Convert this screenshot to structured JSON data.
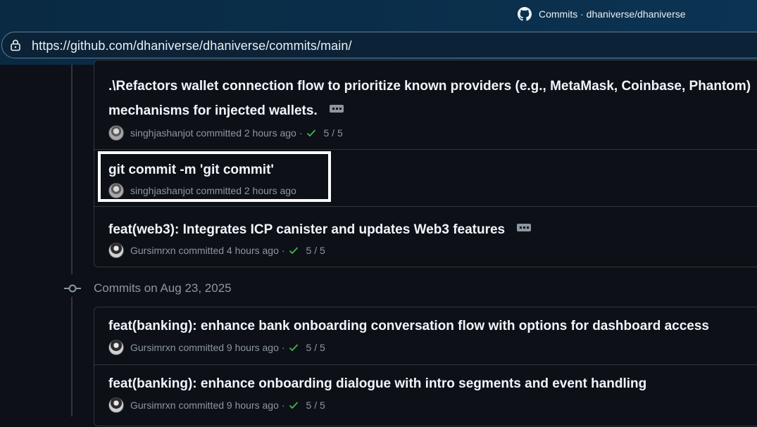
{
  "tab": {
    "title": "Commits · dhaniverse/dhaniverse",
    "icon": "github-icon"
  },
  "addressbar": {
    "url": "https://github.com/dhaniverse/dhaniverse/commits/main/",
    "icon": "lock-icon"
  },
  "group_before": {
    "commits": [
      {
        "title_line1": ".\\Refactors wallet connection flow to prioritize known providers (e.g., MetaMask, Coinbase, Phantom)",
        "title_line2": "mechanisms for injected wallets.",
        "author": "singhjashanjot",
        "action": "committed",
        "time": "2 hours ago",
        "separator": "·",
        "checks": "5 / 5"
      },
      {
        "title": "git commit -m 'git commit'",
        "author": "singhjashanjot",
        "action": "committed",
        "time": "2 hours ago"
      },
      {
        "title": "feat(web3): Integrates ICP canister and updates Web3 features",
        "author": "Gursimrxn",
        "action": "committed",
        "time": "4 hours ago",
        "separator": "·",
        "checks": "5 / 5"
      }
    ]
  },
  "group_aug23": {
    "header": "Commits on Aug 23, 2025",
    "commits": [
      {
        "title": "feat(banking): enhance bank onboarding conversation flow with options for dashboard access",
        "author": "Gursimrxn",
        "action": "committed",
        "time": "9 hours ago",
        "separator": "·",
        "checks": "5 / 5"
      },
      {
        "title": "feat(banking): enhance onboarding dialogue with intro segments and event handling",
        "author": "Gursimrxn",
        "action": "committed",
        "time": "9 hours ago",
        "separator": "·",
        "checks": "5 / 5"
      }
    ]
  },
  "colors": {
    "check": "#3fb950",
    "highlight": "#ffffff"
  }
}
